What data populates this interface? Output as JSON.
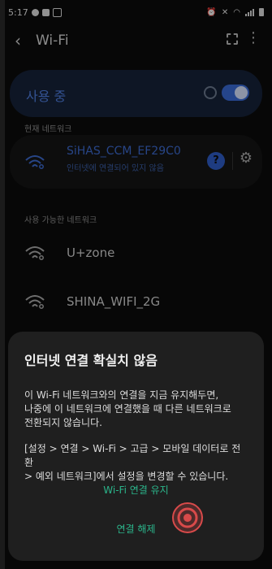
{
  "status_bar": {
    "time": "5:17"
  },
  "app_bar": {
    "title": "Wi-Fi"
  },
  "wifi_switch": {
    "label": "사용 중",
    "on": true
  },
  "current_network": {
    "section_title": "현재 네트워크",
    "ssid": "SiHAS_CCM_EF29C0",
    "status": "인터넷에 연결되어 있지 않음",
    "help_label": "?"
  },
  "available_networks": {
    "section_title": "사용 가능한 네트워크",
    "items": [
      {
        "ssid": "U+zone"
      },
      {
        "ssid": "SHINA_WIFI_2G"
      }
    ]
  },
  "dialog": {
    "title": "인터넷 연결 확실치 않음",
    "message_lines": [
      "이 Wi-Fi 네트워크와의 연결을 지금 유지해두면,",
      "나중에 이 네트워크에 연결했을 때 다른 네트워크로",
      "전환되지 않습니다."
    ],
    "path_lines": [
      "[설정 > 연결 > Wi-Fi > 고급 > 모바일 데이터로 전환",
      "> 예외 네트워크]에서 설정을 변경할 수 있습니다."
    ],
    "keep_label": "Wi-Fi 연결 유지",
    "disconnect_label": "연결 해제"
  },
  "colors": {
    "accent_blue": "#3d6bd0",
    "dialog_button": "#2bb58b",
    "touch_indicator": "#d84a4a"
  }
}
